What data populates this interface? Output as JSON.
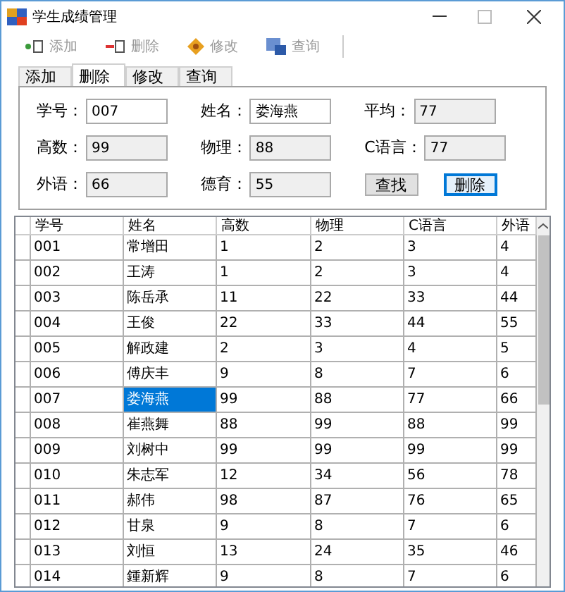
{
  "window": {
    "title": "学生成绩管理"
  },
  "toolbar": [
    {
      "kind": "add",
      "label": "添加",
      "disabled": true
    },
    {
      "kind": "delete",
      "label": "删除",
      "disabled": true
    },
    {
      "kind": "edit",
      "label": "修改",
      "disabled": true
    },
    {
      "kind": "query",
      "label": "查询",
      "disabled": true
    }
  ],
  "tabs": [
    {
      "label": "添加",
      "selected": false
    },
    {
      "label": "删除",
      "selected": true
    },
    {
      "label": "修改",
      "selected": false
    },
    {
      "label": "查询",
      "selected": false
    }
  ],
  "fields": [
    {
      "label": "学号：",
      "value": "007",
      "readonly": false
    },
    {
      "label": "姓名：",
      "value": "娄海燕",
      "readonly": false
    },
    {
      "label": "平均：",
      "value": "77",
      "readonly": true
    },
    {
      "label": "高数：",
      "value": "99",
      "readonly": true
    },
    {
      "label": "物理：",
      "value": "88",
      "readonly": true
    },
    {
      "label": "C语言：",
      "value": "77",
      "readonly": true
    },
    {
      "label": "外语：",
      "value": "66",
      "readonly": true
    },
    {
      "label": "德育：",
      "value": "55",
      "readonly": true
    }
  ],
  "buttons": [
    {
      "label": "查找",
      "focused": false
    },
    {
      "label": "删除",
      "focused": true
    }
  ],
  "table": {
    "columns": [
      "学号",
      "姓名",
      "高数",
      "物理",
      "C语言",
      "外语"
    ],
    "rows": [
      {
        "cells": [
          "001",
          "常增田",
          "1",
          "2",
          "3",
          "4"
        ],
        "selected": false
      },
      {
        "cells": [
          "002",
          "王涛",
          "1",
          "2",
          "3",
          "4"
        ],
        "selected": false
      },
      {
        "cells": [
          "003",
          "陈岳承",
          "11",
          "22",
          "33",
          "44"
        ],
        "selected": false
      },
      {
        "cells": [
          "004",
          "王俊",
          "22",
          "33",
          "44",
          "55"
        ],
        "selected": false
      },
      {
        "cells": [
          "005",
          "解政建",
          "2",
          "3",
          "4",
          "5"
        ],
        "selected": false
      },
      {
        "cells": [
          "006",
          "傅庆丰",
          "9",
          "8",
          "7",
          "6"
        ],
        "selected": false
      },
      {
        "cells": [
          "007",
          "娄海燕",
          "99",
          "88",
          "77",
          "66"
        ],
        "selected": true
      },
      {
        "cells": [
          "008",
          "崔燕舞",
          "88",
          "99",
          "88",
          "99"
        ],
        "selected": false
      },
      {
        "cells": [
          "009",
          "刘树中",
          "99",
          "99",
          "99",
          "99"
        ],
        "selected": false
      },
      {
        "cells": [
          "010",
          "朱志军",
          "12",
          "34",
          "56",
          "78"
        ],
        "selected": false
      },
      {
        "cells": [
          "011",
          "郝伟",
          "98",
          "87",
          "76",
          "65"
        ],
        "selected": false
      },
      {
        "cells": [
          "012",
          "甘泉",
          "9",
          "8",
          "7",
          "6"
        ],
        "selected": false
      },
      {
        "cells": [
          "013",
          "刘恒",
          "13",
          "24",
          "35",
          "46"
        ],
        "selected": false
      },
      {
        "cells": [
          "014",
          "鍾新辉",
          "9",
          "8",
          "7",
          "6"
        ],
        "selected": false
      }
    ]
  }
}
